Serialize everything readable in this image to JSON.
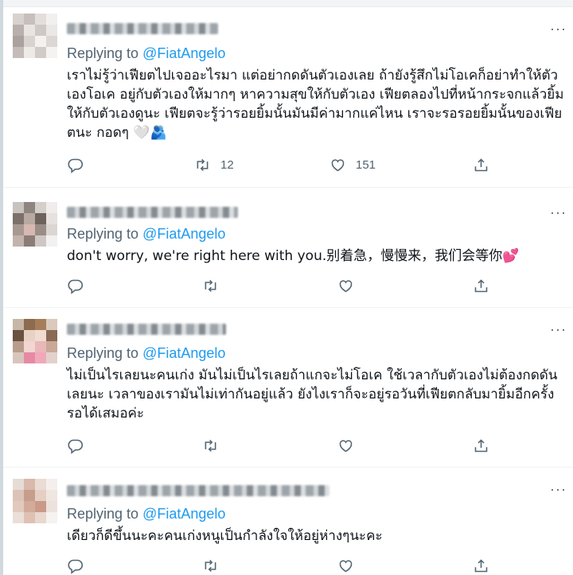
{
  "replies": [
    {
      "replying_prefix": "Replying to",
      "handle": "@FiatAngelo",
      "text": "เราไม่รู้ว่าเฟียตไปเจออะไรมา แต่อย่ากดดันตัวเองเลย ถ้ายังรู้สึกไม่โอเคก็อย่าทำให้ตัวเองโอเค อยู่กับตัวเองให้มากๆ หาความสุขให้กับตัวเอง เฟียตลองไปที่หน้ากระจกแล้วยิ้มให้กับตัวเองดูนะ เฟียตจะรู้ว่ารอยยิ้มนั้นมันมีค่ามากแค่ไหน เราจะรอรอยยิ้มนั้นของเฟียตนะ กอดๆ 🤍🫂",
      "retweets": "12",
      "likes": "151"
    },
    {
      "replying_prefix": "Replying to",
      "handle": "@FiatAngelo",
      "text": "don't  worry, we're right here with you.别着急，慢慢来，我们会等你💕",
      "retweets": "",
      "likes": ""
    },
    {
      "replying_prefix": "Replying to",
      "handle": "@FiatAngelo",
      "text": "ไม่เป็นไรเลยนะคนเก่ง มันไม่เป็นไรเลยถ้าแกจะไม่โอเค ใช้เวลากับตัวเองไม่ต้องกดดันเลยนะ เวลาของเรามันไม่เท่ากันอยู่แล้ว ยังไงเราก็จะอยู่รอวันที่เฟียตกลับมายิ้มอีกครั้ง รอได้เสมอค่ะ",
      "retweets": "",
      "likes": ""
    },
    {
      "replying_prefix": "Replying to",
      "handle": "@FiatAngelo",
      "text": "เดียวก็ดีขึ้นนะคะคนเก่งหนูเป็นกำลังใจให้อยู่ห่างๆนะคะ",
      "retweets": "",
      "likes": ""
    }
  ],
  "icons": {
    "reply": "reply-icon",
    "retweet": "retweet-icon",
    "like": "heart-icon",
    "share": "share-icon",
    "more": "more-icon"
  },
  "more_glyph": "···",
  "colors": {
    "link": "#1d9bf0",
    "muted": "#536471",
    "text": "#0f1419"
  }
}
